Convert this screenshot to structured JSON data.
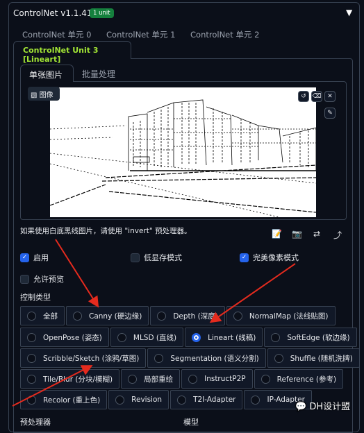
{
  "header": {
    "title": "ControlNet v1.1.419",
    "badge": "1 unit",
    "collapse_icon": "triangle-down"
  },
  "unit_tabs": [
    "ControlNet 单元 0",
    "ControlNet 单元 1",
    "ControlNet 单元 2"
  ],
  "active_unit_tab": "ControlNet Unit 3 [Lineart]",
  "sub_tabs": {
    "active": "单张图片",
    "other": "批量处理"
  },
  "image": {
    "label": "图像",
    "tools": [
      "rotate-icon",
      "eraser-icon",
      "close-icon"
    ],
    "side_tool": "brush-icon"
  },
  "hint": "如果使用白底黑线图片，请使用 \"invert\" 预处理器。",
  "tool_icons": [
    "📝",
    "📷",
    "⇄",
    "⤴"
  ],
  "checkboxes": [
    {
      "label": "启用",
      "checked": true
    },
    {
      "label": "低显存模式",
      "checked": false
    },
    {
      "label": "完美像素模式",
      "checked": true
    },
    {
      "label": "允许预览",
      "checked": false
    }
  ],
  "control_type_label": "控制类型",
  "control_types": [
    [
      "全部",
      "Canny (硬边缘)",
      "Depth (深度)",
      "NormalMap (法线贴图)"
    ],
    [
      "OpenPose (姿态)",
      "MLSD (直线)",
      "Lineart (线稿)",
      "SoftEdge (软边缘)"
    ],
    [
      "Scribble/Sketch (涂鸦/草图)",
      "Segmentation (语义分割)",
      "Shuffle (随机洗牌)"
    ],
    [
      "Tile/Blur (分块/模糊)",
      "局部重绘",
      "InstructP2P",
      "Reference (参考)"
    ],
    [
      "Recolor (重上色)",
      "Revision",
      "T2I-Adapter",
      "IP-Adapter"
    ]
  ],
  "selected_control_type": "Lineart (线稿)",
  "footer_labels": {
    "preprocessor": "预处理器",
    "model": "模型"
  },
  "watermark": "DH设计盟",
  "colors": {
    "accent": "#2563eb",
    "badge": "#15803d",
    "active_tab": "#a3e635",
    "annotation_arrow": "#e52b1e"
  }
}
